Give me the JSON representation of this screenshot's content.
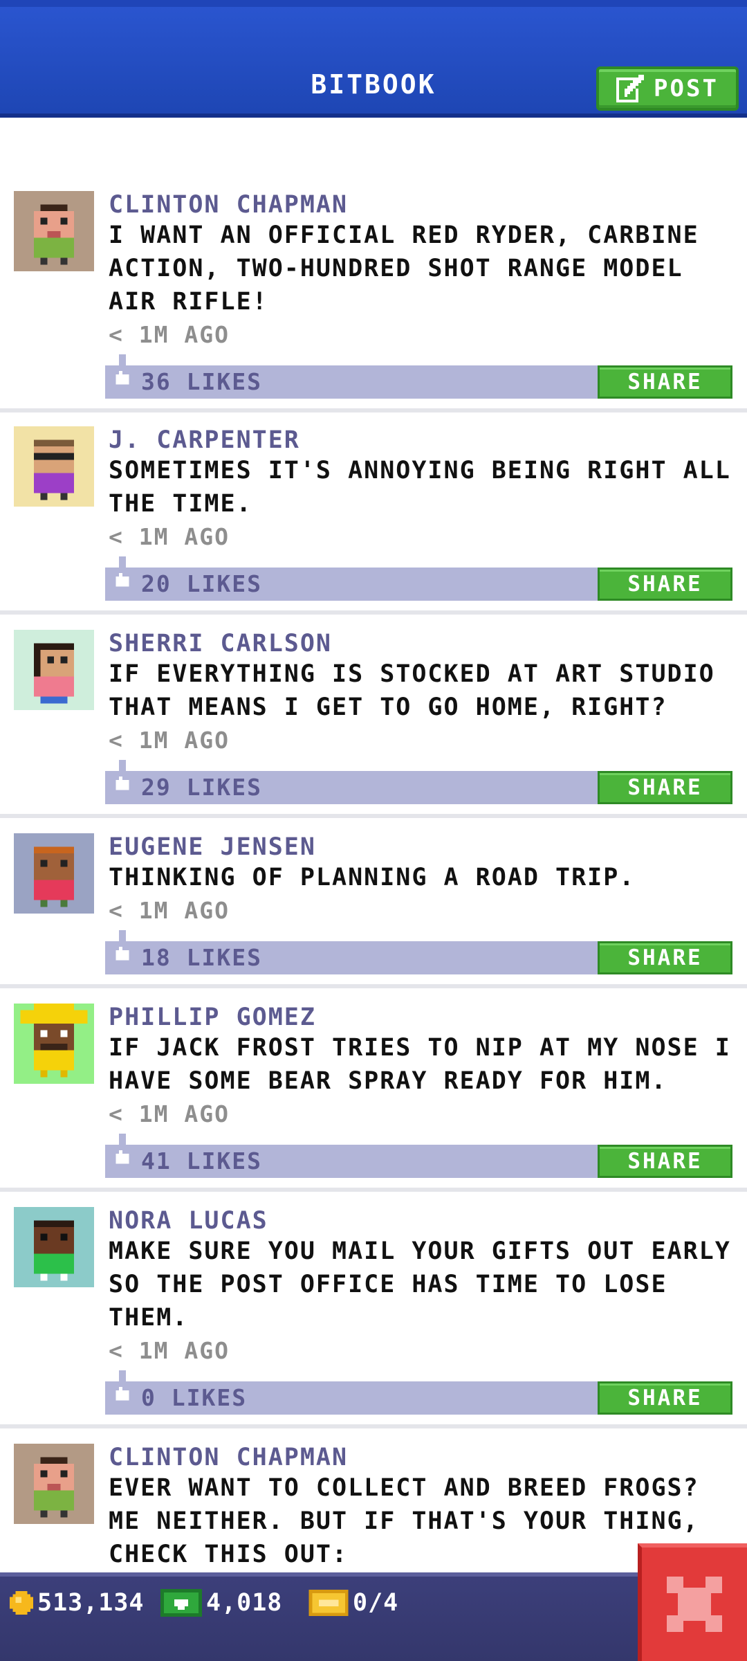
{
  "header": {
    "title": "BITBOOK",
    "post_label": "POST"
  },
  "posts": [
    {
      "author": "CLINTON CHAPMAN",
      "message": "I WANT AN OFFICIAL RED RYDER, CARBINE ACTION, TWO-HUNDRED SHOT RANGE MODEL AIR RIFLE!",
      "time": "< 1M AGO",
      "likes": "36 LIKES",
      "share_label": "SHARE",
      "avatar_bg": "#b39a85"
    },
    {
      "author": "J. CARPENTER",
      "message": "SOMETIMES IT'S ANNOYING BEING RIGHT ALL THE TIME.",
      "time": "< 1M AGO",
      "likes": "20 LIKES",
      "share_label": "SHARE",
      "avatar_bg": "#f2e2a6"
    },
    {
      "author": "SHERRI CARLSON",
      "message": "IF EVERYTHING IS STOCKED AT ART STUDIO THAT MEANS I GET TO GO HOME, RIGHT?",
      "time": "< 1M AGO",
      "likes": "29 LIKES",
      "share_label": "SHARE",
      "avatar_bg": "#cfeedc"
    },
    {
      "author": "EUGENE JENSEN",
      "message": "THINKING OF PLANNING A ROAD TRIP.",
      "time": "< 1M AGO",
      "likes": "18 LIKES",
      "share_label": "SHARE",
      "avatar_bg": "#9aa3c3"
    },
    {
      "author": "PHILLIP GOMEZ",
      "message": "IF JACK FROST TRIES TO NIP AT MY NOSE I HAVE SOME BEAR SPRAY READY FOR HIM.",
      "time": "< 1M AGO",
      "likes": "41 LIKES",
      "share_label": "SHARE",
      "avatar_bg": "#93ef86"
    },
    {
      "author": "NORA LUCAS",
      "message": "MAKE SURE YOU MAIL YOUR GIFTS OUT EARLY SO THE POST OFFICE HAS TIME TO LOSE THEM.",
      "time": "< 1M AGO",
      "likes": "0 LIKES",
      "share_label": "SHARE",
      "avatar_bg": "#8ccbc9"
    },
    {
      "author": "CLINTON CHAPMAN",
      "message": "EVER WANT TO COLLECT AND BREED FROGS? ME NEITHER. BUT IF THAT'S YOUR THING, CHECK THIS OUT:",
      "time": "",
      "likes": "",
      "share_label": "",
      "avatar_bg": "#b39a85"
    }
  ],
  "bottom_bar": {
    "coins": "513,134",
    "bux": "4,018",
    "tickets": "0/4"
  },
  "colors": {
    "header_blue": "#2a55cf",
    "share_green": "#4bb43a",
    "likes_bar": "#b2b5d8",
    "close_red": "#e23a3a"
  },
  "icons": {
    "post": "edit-icon",
    "likes": "thumb-up-icon",
    "coins": "coin-icon",
    "bux": "bux-icon",
    "tickets": "ticket-icon",
    "close": "close-icon"
  }
}
